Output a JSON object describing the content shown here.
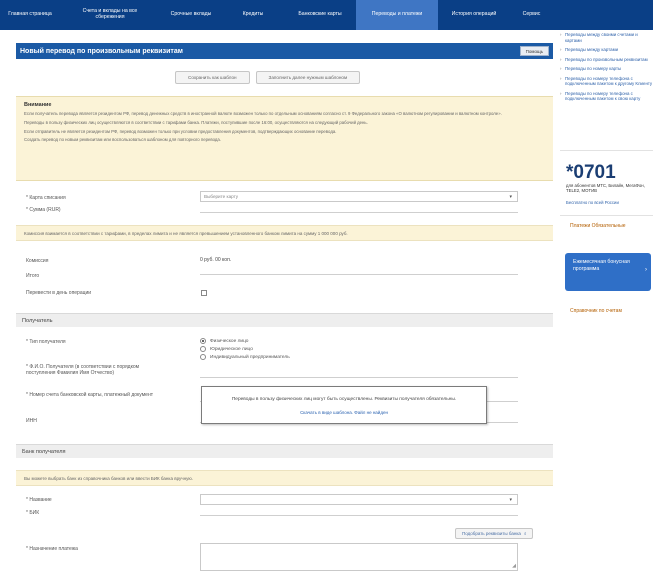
{
  "nav": {
    "items": [
      {
        "label": "Главная страница"
      },
      {
        "label": "Счета и вклады на все сбережения"
      },
      {
        "label": "Срочные вклады"
      },
      {
        "label": "Кредиты"
      },
      {
        "label": "Банковские карты"
      },
      {
        "label": "Переводы и платежи"
      },
      {
        "label": "История операций"
      },
      {
        "label": "Сервис"
      }
    ],
    "active_index": 5
  },
  "title": {
    "text": "Новый перевод по произвольным реквизитам",
    "help": "Помощь"
  },
  "templates": {
    "save": "Сохранить как шаблон",
    "fill": "Заполнить далее нужным шаблоном"
  },
  "notice": {
    "title": "Внимание",
    "p1": "Если получатель перевода является резидентом РФ, перевод денежных средств в иностранной валюте возможен только по отдельным основаниям согласно ст. 9 Федерального закона «О валютном регулировании и валютном контроле».",
    "p2": "Переводы в пользу физических лиц осуществляются в соответствии с тарифами банка. Платежи, поступившие после 16:00, осуществляются на следующий рабочий день.",
    "p3": "Если отправитель не является резидентом РФ, перевод возможен только при условии предоставления документов, подтверждающих основание перевода.",
    "p4": "Создать перевод по новым реквизитам или воспользоваться шаблоном для повторного перевода."
  },
  "form": {
    "card_label": "* Карта списания",
    "card_value": "Выберите карту",
    "amount_label": "* Сумма (RUR)",
    "info_line": "Комиссия взимается в соответствии с тарифами, в пределах лимита и не является превышением установленного банком лимита на сумму 1 000 000 руб.",
    "commission_label": "Комиссия",
    "commission_value": "0 руб. 00 коп.",
    "total_label": "Итого",
    "urgent_label": "Перевести в день операции"
  },
  "payee": {
    "section_title": "Получатель",
    "type_label": "* Тип получателя",
    "type_options": [
      "Физическое лицо",
      "Юридическое лицо",
      "Индивидуальный предприниматель"
    ],
    "type_selected": 0,
    "name_label": "* Ф.И.О. Получателя (в соответствии с порядком поступления Фамилия Имя Отчество)",
    "account_label": "* Номер счета банковской карты, платежный документ",
    "inn_label": "ИНН",
    "popup_text": "Переводы в пользу физических лиц могут быть осуществлены. Реквизиты получателя обязательны.",
    "popup_link": "Скачать в виде шаблона. Файл не найден"
  },
  "bank": {
    "section_title": "Банк получателя",
    "info_line": "Вы можете выбрать банк из справочника банков или ввести БИК банка вручную.",
    "name_label": "* Название",
    "bik_label": "* БИК",
    "find_button": "Подобрать реквизиты банка",
    "purpose_label": "* Назначение платежа"
  },
  "sidebar": {
    "links": [
      "Переводы между своими счетами и картами",
      "Переводы между картами",
      "Переводы по произвольным реквизитам",
      "Переводы по номеру карты",
      "Переводы по номеру телефона с подключенным пакетом к другому Клиенту",
      "Переводы по номеру телефона с подключенным пакетом к свою карту"
    ],
    "phone": "*0701",
    "phone_note": "для абонентов МТС, Билайн, МегаФон, TELE2, МОТИВ",
    "phone_link": "Бесплатно по всей России",
    "item1": "Платежи Обязательные",
    "blue_box": "Ежемесячная бонусная программа",
    "item2": "Справочник по счетам"
  }
}
